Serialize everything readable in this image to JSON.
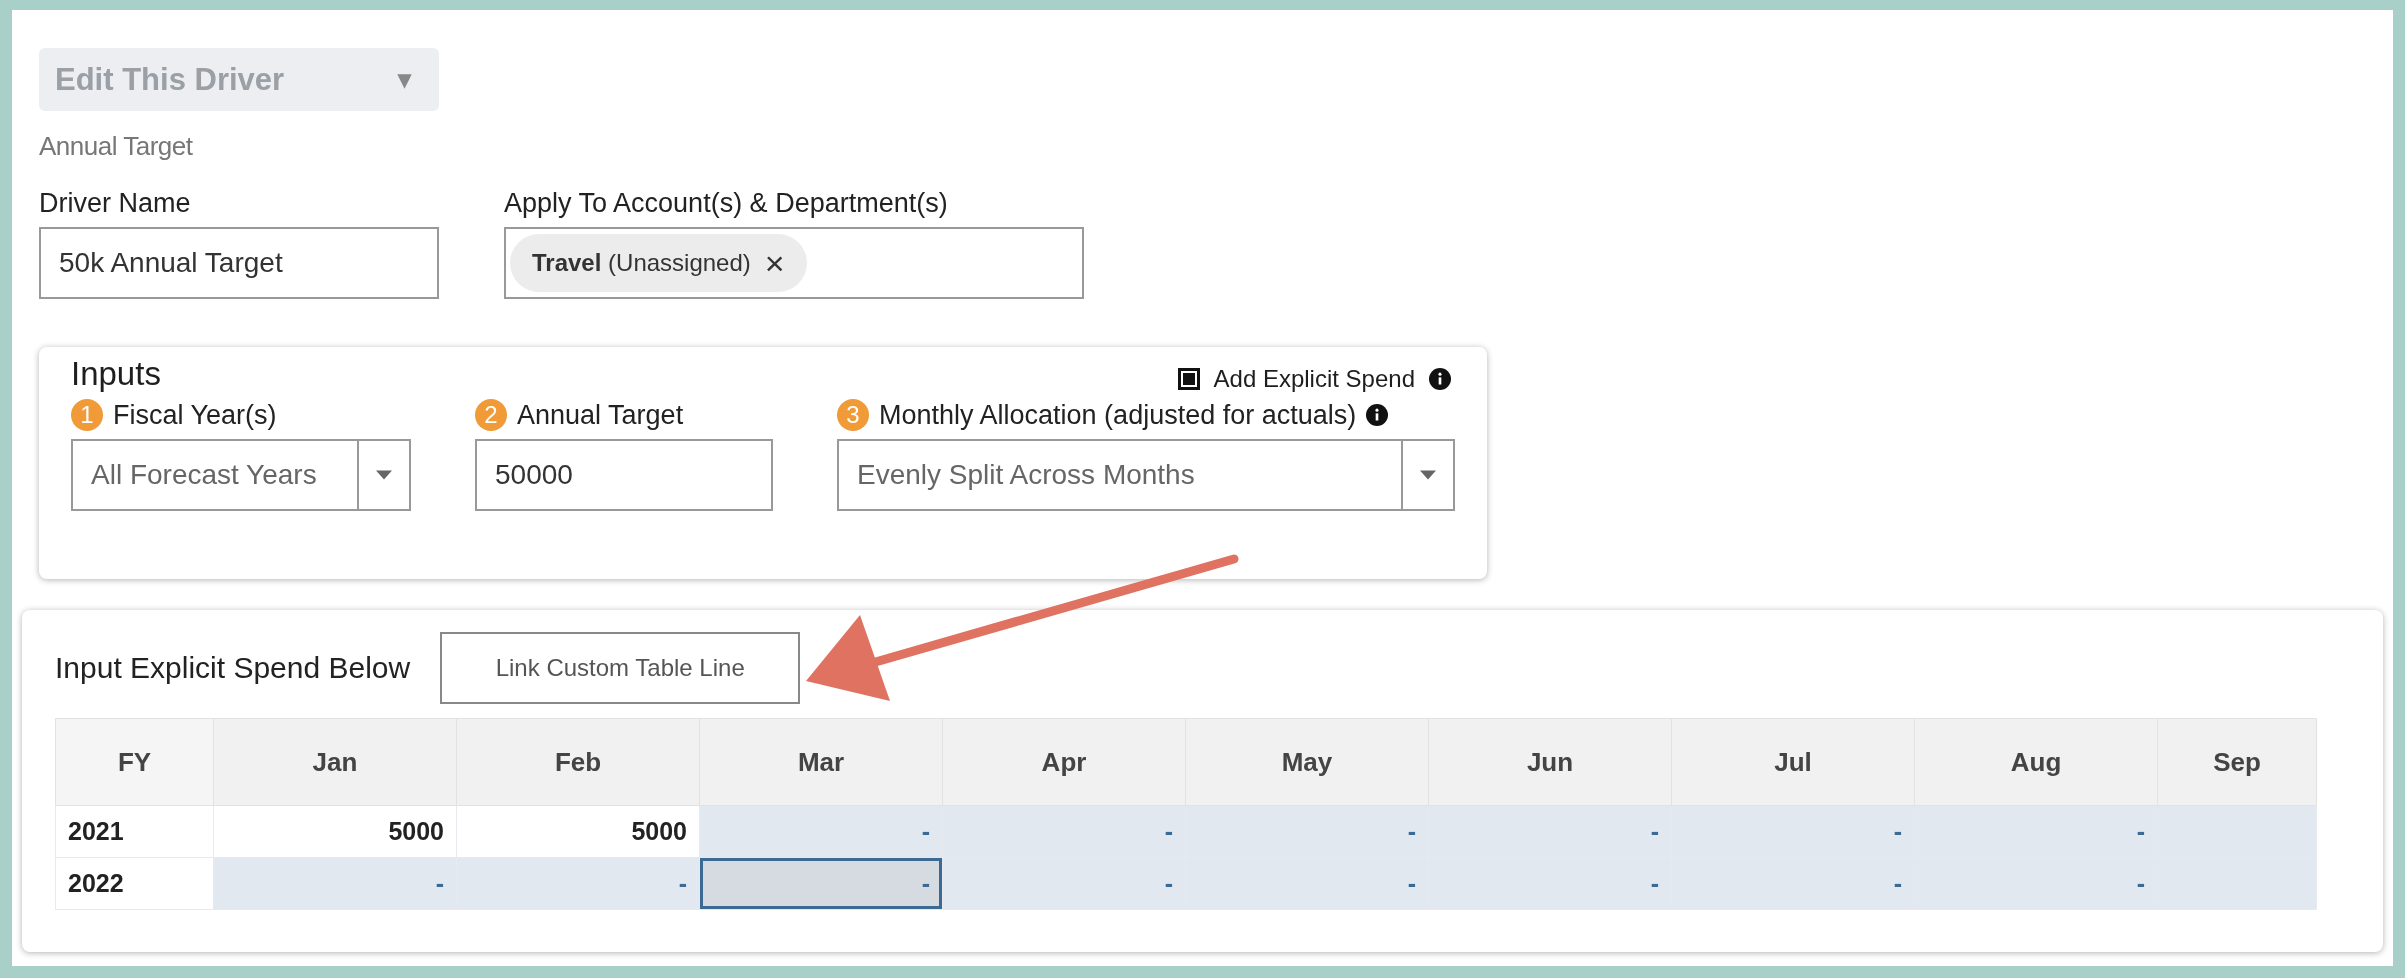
{
  "driver_menu": {
    "label": "Edit This Driver",
    "caret": "▾"
  },
  "driver_type": "Annual Target",
  "driver_name": {
    "label": "Driver Name",
    "value": "50k Annual Target"
  },
  "apply_to": {
    "label": "Apply To Account(s) & Department(s)",
    "tags": [
      {
        "name": "Travel",
        "detail": "(Unassigned)",
        "remove": "×"
      }
    ]
  },
  "inputs": {
    "title": "Inputs",
    "explicit_spend": {
      "label": "Add Explicit Spend",
      "checked": true
    },
    "fields": [
      {
        "kind": "dropdown",
        "step": "1",
        "label": "Fiscal Year(s)",
        "value": "All Forecast Years",
        "info": false
      },
      {
        "kind": "text",
        "step": "2",
        "label": "Annual Target",
        "value": "50000",
        "info": false
      },
      {
        "kind": "dropdown",
        "step": "3",
        "label": "Monthly Allocation (adjusted for actuals)",
        "value": "Evenly Split Across Months",
        "info": true
      }
    ]
  },
  "explicit_spend": {
    "title": "Input Explicit Spend Below",
    "link_button": "Link Custom Table Line",
    "table": {
      "columns": [
        "FY",
        "Jan",
        "Feb",
        "Mar",
        "Apr",
        "May",
        "Jun",
        "Jul",
        "Aug",
        "Sep"
      ],
      "rows": [
        {
          "cells": [
            {
              "value": "2021",
              "kind": "year"
            },
            {
              "value": "5000",
              "kind": "entered",
              "selected": false
            },
            {
              "value": "5000",
              "kind": "entered",
              "selected": false
            },
            {
              "value": "-",
              "kind": "blank",
              "selected": false
            },
            {
              "value": "-",
              "kind": "blank",
              "selected": false
            },
            {
              "value": "-",
              "kind": "blank",
              "selected": false
            },
            {
              "value": "-",
              "kind": "blank",
              "selected": false
            },
            {
              "value": "-",
              "kind": "blank",
              "selected": false
            },
            {
              "value": "-",
              "kind": "blank",
              "selected": false
            }
          ]
        },
        {
          "cells": [
            {
              "value": "2022",
              "kind": "year"
            },
            {
              "value": "-",
              "kind": "blank",
              "selected": false
            },
            {
              "value": "-",
              "kind": "blank",
              "selected": false
            },
            {
              "value": "-",
              "kind": "blank",
              "selected": true
            },
            {
              "value": "-",
              "kind": "blank",
              "selected": false
            },
            {
              "value": "-",
              "kind": "blank",
              "selected": false
            },
            {
              "value": "-",
              "kind": "blank",
              "selected": false
            },
            {
              "value": "-",
              "kind": "blank",
              "selected": false
            },
            {
              "value": "-",
              "kind": "blank",
              "selected": false
            }
          ]
        }
      ]
    }
  }
}
